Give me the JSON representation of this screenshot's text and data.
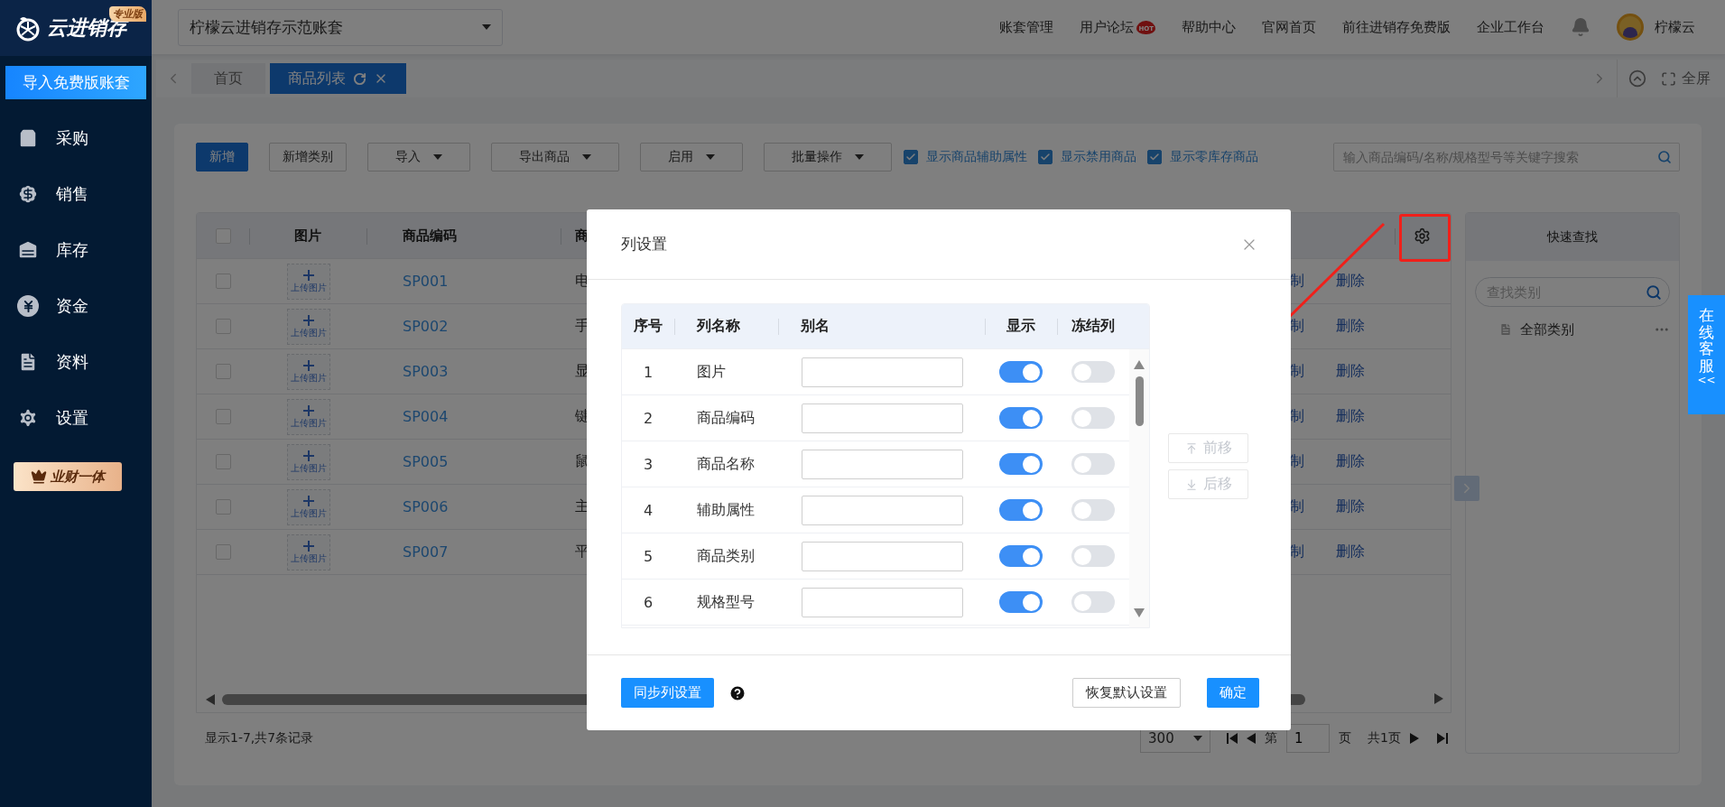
{
  "sidebar": {
    "logo": "云进销存",
    "edition": "专业版",
    "import_button": "导入免费版账套",
    "items": [
      {
        "label": "采购"
      },
      {
        "label": "销售"
      },
      {
        "label": "库存"
      },
      {
        "label": "资金"
      },
      {
        "label": "资料"
      },
      {
        "label": "设置"
      }
    ],
    "promo": "业财一体"
  },
  "header": {
    "account": "柠檬云进销存示范账套",
    "links": [
      {
        "label": "账套管理"
      },
      {
        "label": "用户论坛",
        "badge": "HOT"
      },
      {
        "label": "帮助中心"
      },
      {
        "label": "官网首页"
      },
      {
        "label": "前往进销存免费版"
      },
      {
        "label": "企业工作台"
      }
    ],
    "user": "柠檬云"
  },
  "tabs": [
    {
      "label": "首页",
      "selected": false
    },
    {
      "label": "商品列表",
      "selected": true
    }
  ],
  "fullscreen": "全屏",
  "toolbar": {
    "buttons": [
      {
        "label": "新增",
        "kind": "primary"
      },
      {
        "label": "新增类别",
        "kind": "plain"
      },
      {
        "label": "导入",
        "kind": "dropdown"
      },
      {
        "label": "导出商品",
        "kind": "dropdown"
      },
      {
        "label": "启用",
        "kind": "dropdown"
      },
      {
        "label": "批量操作",
        "kind": "dropdown"
      }
    ],
    "checkboxes": [
      {
        "label": "显示商品辅助属性",
        "checked": true
      },
      {
        "label": "显示禁用商品",
        "checked": true
      },
      {
        "label": "显示零库存商品",
        "checked": true
      }
    ],
    "search_placeholder": "输入商品编码/名称/规格型号等关键字搜索"
  },
  "table": {
    "header_checked": false,
    "columns": [
      "图片",
      "商品编码",
      "商"
    ],
    "rows": [
      {
        "checked": false,
        "upload": "上传图片",
        "code": "SP001",
        "name": "电",
        "action_1": "制",
        "action_2": "删除"
      },
      {
        "checked": false,
        "upload": "上传图片",
        "code": "SP002",
        "name": "手",
        "action_1": "制",
        "action_2": "删除"
      },
      {
        "checked": false,
        "upload": "上传图片",
        "code": "SP003",
        "name": "显",
        "action_1": "制",
        "action_2": "删除"
      },
      {
        "checked": false,
        "upload": "上传图片",
        "code": "SP004",
        "name": "键",
        "action_1": "制",
        "action_2": "删除"
      },
      {
        "checked": false,
        "upload": "上传图片",
        "code": "SP005",
        "name": "鼠",
        "action_1": "制",
        "action_2": "删除"
      },
      {
        "checked": false,
        "upload": "上传图片",
        "code": "SP006",
        "name": "主",
        "action_1": "制",
        "action_2": "删除"
      },
      {
        "checked": false,
        "upload": "上传图片",
        "code": "SP007",
        "name": "平",
        "action_1": "制",
        "action_2": "删除"
      }
    ]
  },
  "pager": {
    "summary": "显示1-7,共7条记录",
    "page_size": "300",
    "before_page": "第",
    "page": "1",
    "after_page": "页",
    "total": "共1页"
  },
  "quick_find": {
    "title": "快速查找",
    "placeholder": "查找类别",
    "items": [
      {
        "label": "全部类别"
      }
    ]
  },
  "service_tab": {
    "label": "在线客服",
    "arrows": "<<"
  },
  "dialog": {
    "title": "列设置",
    "columns": [
      "序号",
      "列名称",
      "别名",
      "显示",
      "冻结列"
    ],
    "rows": [
      {
        "index": "1",
        "name": "图片",
        "visible": true,
        "frozen": false
      },
      {
        "index": "2",
        "name": "商品编码",
        "visible": true,
        "frozen": false
      },
      {
        "index": "3",
        "name": "商品名称",
        "visible": true,
        "frozen": false
      },
      {
        "index": "4",
        "name": "辅助属性",
        "visible": true,
        "frozen": false
      },
      {
        "index": "5",
        "name": "商品类别",
        "visible": true,
        "frozen": false
      },
      {
        "index": "6",
        "name": "规格型号",
        "visible": true,
        "frozen": false
      }
    ],
    "move_buttons": [
      {
        "label": "前移",
        "disabled": true
      },
      {
        "label": "后移",
        "disabled": true
      }
    ],
    "sync_button": "同步列设置",
    "reset_button": "恢复默认设置",
    "ok_button": "确定"
  }
}
